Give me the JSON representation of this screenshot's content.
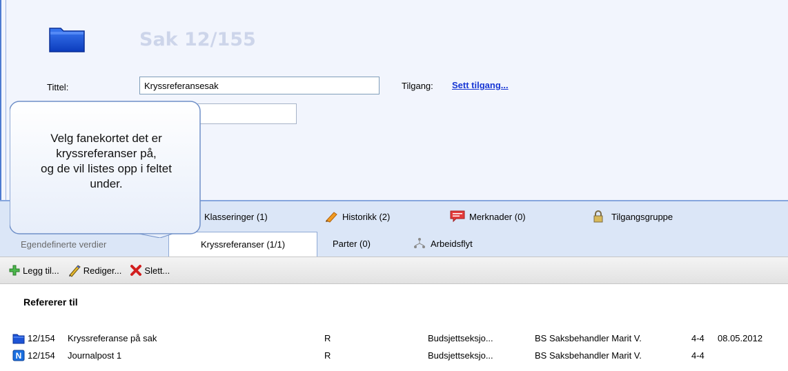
{
  "case": {
    "title": "Sak 12/155",
    "title_label": "Tittel:",
    "title_value": "Kryssreferansesak",
    "access_label": "Tilgang:",
    "access_link": "Sett tilgang..."
  },
  "callout": {
    "line1": "Velg fanekortet det er",
    "line2": "kryssreferanser på,",
    "line3": "og de vil listes opp i feltet",
    "line4": "under."
  },
  "tabs": {
    "row1": [
      "Klasseringer (1)",
      "Historikk (2)",
      "Merknader (0)",
      "Tilgangsgruppe"
    ],
    "row2": [
      "Egendefinerte verdier",
      "Kryssreferanser (1/1)",
      "Parter (0)",
      "Arbeidsflyt"
    ]
  },
  "toolbar": {
    "add": "Legg til...",
    "edit": "Rediger...",
    "delete": "Slett..."
  },
  "list": {
    "header": "Refererer til",
    "rows": [
      {
        "id": "12/154",
        "title": "Kryssreferanse på sak",
        "code": "R",
        "unit": "Budsjettseksjo...",
        "handler": "BS Saksbehandler Marit V.",
        "num": "4-4",
        "date": "08.05.2012"
      },
      {
        "id": "12/154",
        "title": "Journalpost 1",
        "code": "R",
        "unit": "Budsjettseksjo...",
        "handler": "BS Saksbehandler Marit V.",
        "num": "4-4",
        "date": ""
      }
    ]
  },
  "colors": {
    "folder": "#1d54d6",
    "link": "#1736d4",
    "tab_band": "#dbe6f7"
  }
}
